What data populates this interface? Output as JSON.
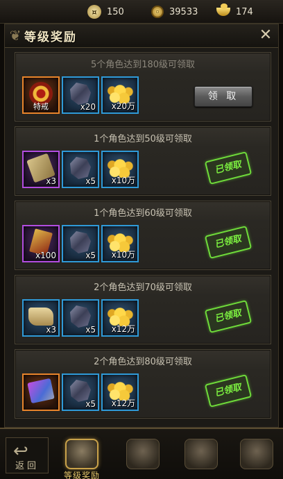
{
  "resources": [
    {
      "icon": "silver-coin-icon",
      "value": "150"
    },
    {
      "icon": "copper-coin-icon",
      "value": "39533"
    },
    {
      "icon": "gold-ingot-icon",
      "value": "174"
    }
  ],
  "panel": {
    "title": "等级奖励"
  },
  "rewards": [
    {
      "title": "5个角色达到180级可领取",
      "status": "claimable",
      "action_label": "领 取",
      "items": [
        {
          "icon": "ring-icon",
          "quality": "orange",
          "name": "特戒",
          "qty": ""
        },
        {
          "icon": "ore-icon",
          "quality": "blue",
          "name": "",
          "qty": "x20"
        },
        {
          "icon": "gold-coins-icon",
          "quality": "blue",
          "name": "",
          "qty": "x20万"
        }
      ]
    },
    {
      "title": "1个角色达到50级可领取",
      "status": "claimed",
      "action_label": "已领取",
      "items": [
        {
          "icon": "scroll-icon",
          "quality": "purple",
          "name": "",
          "qty": "x3"
        },
        {
          "icon": "ore-icon",
          "quality": "blue",
          "name": "",
          "qty": "x5"
        },
        {
          "icon": "gold-coins-icon",
          "quality": "blue",
          "name": "",
          "qty": "x10万"
        }
      ]
    },
    {
      "title": "1个角色达到60级可领取",
      "status": "claimed",
      "action_label": "已领取",
      "items": [
        {
          "icon": "red-book-icon",
          "quality": "purple",
          "name": "",
          "qty": "x100"
        },
        {
          "icon": "ore-icon",
          "quality": "blue",
          "name": "",
          "qty": "x5"
        },
        {
          "icon": "gold-coins-icon",
          "quality": "blue",
          "name": "",
          "qty": "x10万"
        }
      ]
    },
    {
      "title": "2个角色达到70级可领取",
      "status": "claimed",
      "action_label": "已领取",
      "items": [
        {
          "icon": "map-scroll-icon",
          "quality": "blue",
          "name": "",
          "qty": "x3"
        },
        {
          "icon": "ore-icon",
          "quality": "blue",
          "name": "",
          "qty": "x5"
        },
        {
          "icon": "gold-coins-icon",
          "quality": "blue",
          "name": "",
          "qty": "x12万"
        }
      ]
    },
    {
      "title": "2个角色达到80级可领取",
      "status": "claimed",
      "action_label": "已领取",
      "items": [
        {
          "icon": "cloth-icon",
          "quality": "orange",
          "name": "",
          "qty": ""
        },
        {
          "icon": "ore-icon",
          "quality": "blue",
          "name": "",
          "qty": "x5"
        },
        {
          "icon": "gold-coins-icon",
          "quality": "blue",
          "name": "",
          "qty": "x12万"
        }
      ]
    }
  ],
  "bottom_nav": {
    "back_label": "返回",
    "tabs": [
      {
        "icon": "treasure-icon",
        "label": "等级奖励",
        "active": true
      },
      {
        "icon": "lion-icon",
        "label": "",
        "active": false
      },
      {
        "icon": "chest-icon",
        "label": "",
        "active": false
      },
      {
        "icon": "armor-icon",
        "label": "",
        "active": false
      }
    ]
  },
  "colors": {
    "quality_blue": "#2f9ad8",
    "quality_purple": "#b24de0",
    "quality_orange": "#e8842b",
    "claimed_stamp": "#6fdc3a",
    "title_gold": "#efe4c2"
  }
}
